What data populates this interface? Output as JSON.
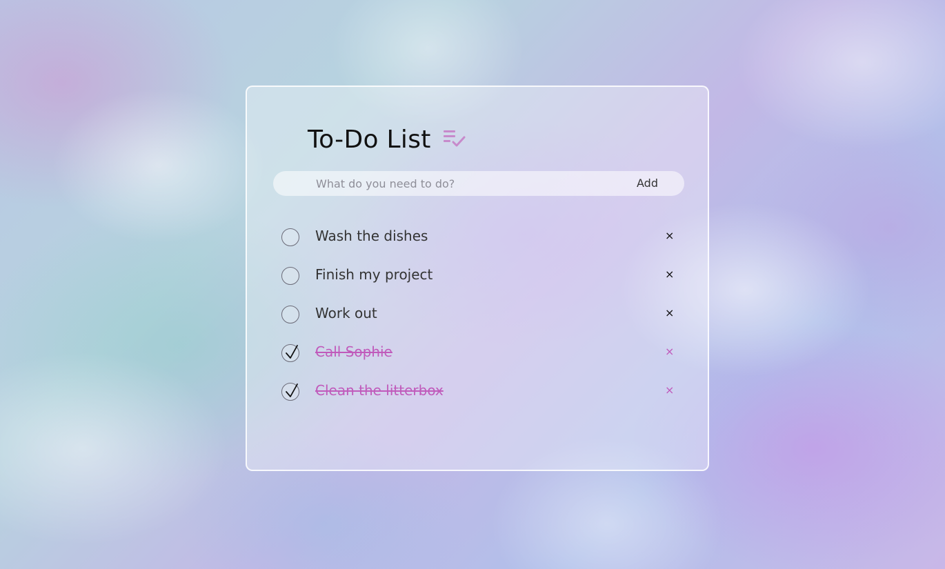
{
  "app": {
    "title": "To-Do List",
    "title_icon": "playlist-check-icon",
    "accent_color": "#c05abb"
  },
  "new_todo": {
    "placeholder": "What do you need to do?",
    "value": "",
    "add_label": "Add"
  },
  "todos": [
    {
      "text": "Wash the dishes",
      "completed": false,
      "delete_label": "×"
    },
    {
      "text": "Finish my project",
      "completed": false,
      "delete_label": "×"
    },
    {
      "text": "Work out",
      "completed": false,
      "delete_label": "×"
    },
    {
      "text": "Call Sophie",
      "completed": true,
      "delete_label": "×"
    },
    {
      "text": "Clean the litterbox",
      "completed": true,
      "delete_label": "×"
    }
  ]
}
